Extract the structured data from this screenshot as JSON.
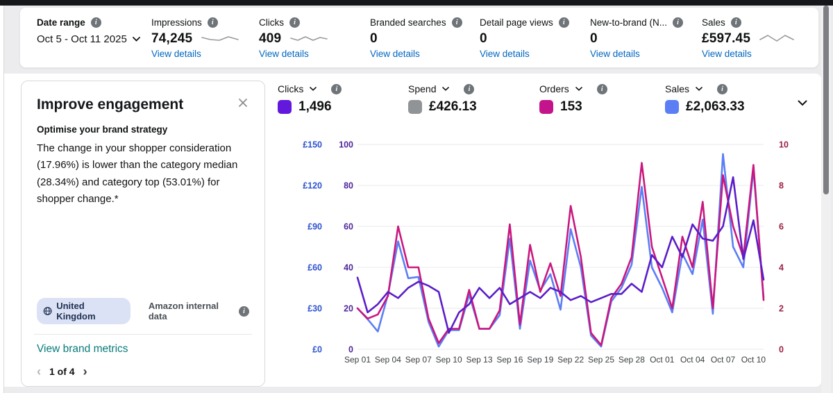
{
  "top_metrics": {
    "date_range": {
      "label": "Date range",
      "value": "Oct 5 - Oct 11 2025"
    },
    "items": [
      {
        "label": "Impressions",
        "value": "74,245",
        "link": "View details"
      },
      {
        "label": "Clicks",
        "value": "409",
        "link": "View details"
      },
      {
        "label": "Branded searches",
        "value": "0",
        "link": "View details"
      },
      {
        "label": "Detail page views",
        "value": "0",
        "link": "View details"
      },
      {
        "label": "New-to-brand (N...",
        "value": "0",
        "link": "View details"
      },
      {
        "label": "Sales",
        "value": "£597.45",
        "link": "View details"
      }
    ]
  },
  "insight_card": {
    "title": "Improve engagement",
    "subtitle": "Optimise your brand strategy",
    "body": "The change in your shopper consideration (17.96%) is lower than the category median (28.34%) and category top (53.01%) for shopper change.*",
    "region_tag": "United Kingdom",
    "source": "Amazon internal data",
    "link": "View brand metrics",
    "pagination": "1 of 4",
    "prev_glyph": "‹",
    "next_glyph": "›"
  },
  "chart_metrics": [
    {
      "label": "Clicks",
      "value": "1,496",
      "color": "#6218dd"
    },
    {
      "label": "Spend",
      "value": "£426.13",
      "color": "#919497"
    },
    {
      "label": "Orders",
      "value": "153",
      "color": "#c4148c"
    },
    {
      "label": "Sales",
      "value": "£2,063.33",
      "color": "#5b7ef5"
    }
  ],
  "chart_data": {
    "type": "line",
    "x": [
      "Sep 01",
      "Sep 02",
      "Sep 03",
      "Sep 04",
      "Sep 05",
      "Sep 06",
      "Sep 07",
      "Sep 08",
      "Sep 09",
      "Sep 10",
      "Sep 11",
      "Sep 12",
      "Sep 13",
      "Sep 14",
      "Sep 15",
      "Sep 16",
      "Sep 17",
      "Sep 18",
      "Sep 19",
      "Sep 20",
      "Sep 21",
      "Sep 22",
      "Sep 23",
      "Sep 24",
      "Sep 25",
      "Sep 26",
      "Sep 27",
      "Sep 28",
      "Sep 29",
      "Sep 30",
      "Oct 01",
      "Oct 02",
      "Oct 03",
      "Oct 04",
      "Oct 05",
      "Oct 06",
      "Oct 07",
      "Oct 08",
      "Oct 09",
      "Oct 10",
      "Oct 11"
    ],
    "x_tick_every": 3,
    "grid": true,
    "axes": {
      "sales": {
        "title": "Sales (£)",
        "ticks": [
          "£150",
          "£120",
          "£90",
          "£60",
          "£30",
          "£0"
        ],
        "max": 150,
        "color": "#2d53cf",
        "position": "left-outer"
      },
      "clicks": {
        "title": "Clicks",
        "ticks": [
          "100",
          "80",
          "60",
          "40",
          "20",
          "0"
        ],
        "max": 100,
        "color": "#50269b",
        "position": "left-inner"
      },
      "orders": {
        "title": "Orders",
        "ticks": [
          "10",
          "8",
          "6",
          "4",
          "2",
          "0"
        ],
        "max": 10,
        "color": "#9c2144",
        "position": "right"
      }
    },
    "series": [
      {
        "name": "Sales",
        "axis": "sales",
        "color": "#5b7ef5",
        "values": [
          30,
          22,
          13,
          40,
          79,
          52,
          53,
          20,
          2,
          14,
          14,
          40,
          15,
          15,
          25,
          81,
          15,
          65,
          43,
          55,
          29,
          88,
          60,
          10,
          2,
          35,
          45,
          62,
          119,
          60,
          45,
          27,
          70,
          55,
          95,
          26,
          143,
          75,
          60,
          132,
          38
        ]
      },
      {
        "name": "Orders",
        "axis": "orders",
        "color": "#c9177e",
        "values": [
          2.0,
          1.5,
          1.7,
          2.6,
          6.0,
          4.0,
          4.0,
          1.5,
          0.3,
          1.0,
          1.0,
          2.9,
          1.0,
          1.0,
          1.9,
          6.1,
          1.2,
          5.1,
          2.8,
          4.2,
          2.6,
          7.0,
          4.5,
          0.8,
          0.2,
          2.5,
          3.2,
          4.5,
          9.1,
          5.0,
          3.5,
          2.0,
          5.5,
          4.0,
          7.2,
          2.0,
          8.5,
          6.0,
          4.5,
          9.0,
          2.4
        ]
      },
      {
        "name": "Clicks",
        "axis": "clicks",
        "color": "#5a1dc8",
        "values": [
          35,
          18,
          22,
          28,
          25,
          30,
          33,
          31,
          28,
          8,
          18,
          22,
          30,
          25,
          30,
          22,
          25,
          28,
          25,
          30,
          28,
          24,
          26,
          23,
          25,
          27,
          27,
          32,
          28,
          46,
          40,
          55,
          45,
          61,
          54,
          53,
          60,
          84,
          44,
          63,
          34
        ]
      }
    ],
    "note": "Spend (grey) metric selected in header but no visible spend line rendered in chart"
  }
}
